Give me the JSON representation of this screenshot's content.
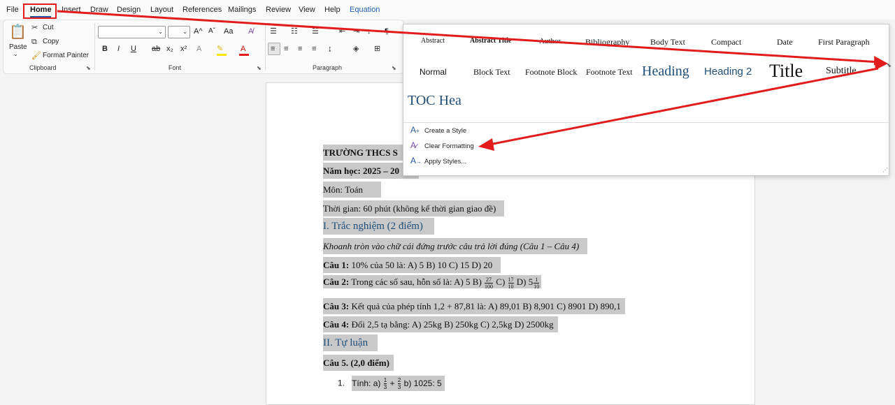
{
  "menu": {
    "tabs": [
      "File",
      "Home",
      "Insert",
      "Draw",
      "Design",
      "Layout",
      "References",
      "Mailings",
      "Review",
      "View",
      "Help",
      "Equation"
    ],
    "active": "Home"
  },
  "clipboard": {
    "paste": "Paste",
    "cut": "Cut",
    "copy": "Copy",
    "format_painter": "Format Painter",
    "group_label": "Clipboard"
  },
  "font": {
    "group_label": "Font",
    "bold": "B",
    "italic": "I",
    "underline": "U",
    "strike": "ab",
    "subscript": "x₂",
    "superscript": "x²",
    "grow": "A^",
    "shrink": "Aˇ",
    "case": "Aa",
    "font_color": "A"
  },
  "paragraph": {
    "group_label": "Paragraph",
    "pilcrow": "¶"
  },
  "styles_gallery": {
    "row1": [
      "Abstract",
      "Abstract Title",
      "Author",
      "Bibliography",
      "Body Text",
      "Compact",
      "Date",
      "First Paragraph"
    ],
    "row2": [
      "Normal",
      "Block Text",
      "Footnote Block",
      "Footnote Text",
      "Heading",
      "Heading 2",
      "Title",
      "Subtitle"
    ],
    "row3": [
      "TOC Hea"
    ],
    "menu": [
      "Create a Style",
      "Clear Formatting",
      "Apply Styles..."
    ]
  },
  "document": {
    "l1": "TRƯỜNG THCS S",
    "l2": "Năm học: 2025 – 20",
    "l3": "Môn: Toán",
    "l4": "Thời gian: 60 phút (không kể thời gian giao đề)",
    "h1": "I. Trắc nghiệm (2 điểm)",
    "instr": "Khoanh tròn vào chữ cái đứng trước câu trả lời đúng (Câu 1 – Câu 4)",
    "q1_label": "Câu 1:",
    "q1_text": " 10% của 50 là: A) 5 B) 10 C) 15 D) 20",
    "q2_label": "Câu 2:",
    "q2_text_a": " Trong các số sau, hỗn số là: A) 5 B) ",
    "q2_frac1_num": "27",
    "q2_frac1_den": "100",
    "q2_text_b": " C) ",
    "q2_frac2_num": "17",
    "q2_frac2_den": "10",
    "q2_text_c": " D) 5",
    "q2_frac3_num": "1",
    "q2_frac3_den": "10",
    "q3_label": "Câu 3:",
    "q3_text": " Kết quả của phép tính 1,2 + 87,81 là: A) 89,01 B) 8,901 C) 8901 D) 890,1",
    "q4_label": "Câu 4:",
    "q4_text": " Đổi 2,5 tạ bằng: A) 25kg B) 250kg C) 2,5kg D) 2500kg",
    "h2": "II. Tự luận",
    "q5": "Câu 5. (2,0 điểm)",
    "item1_num": "1.",
    "item1_a": "Tính: a) ",
    "item1_f1_num": "1",
    "item1_f1_den": "3",
    "item1_plus": " + ",
    "item1_f2_num": "2",
    "item1_f2_den": "3",
    "item1_b": " b) 1025: 5"
  },
  "colors": {
    "annotation_red": "#e21c1c",
    "heading_blue": "#1f4e79",
    "selection_gray": "#c9c9c9",
    "ribbon_accent": "#2b579a"
  }
}
